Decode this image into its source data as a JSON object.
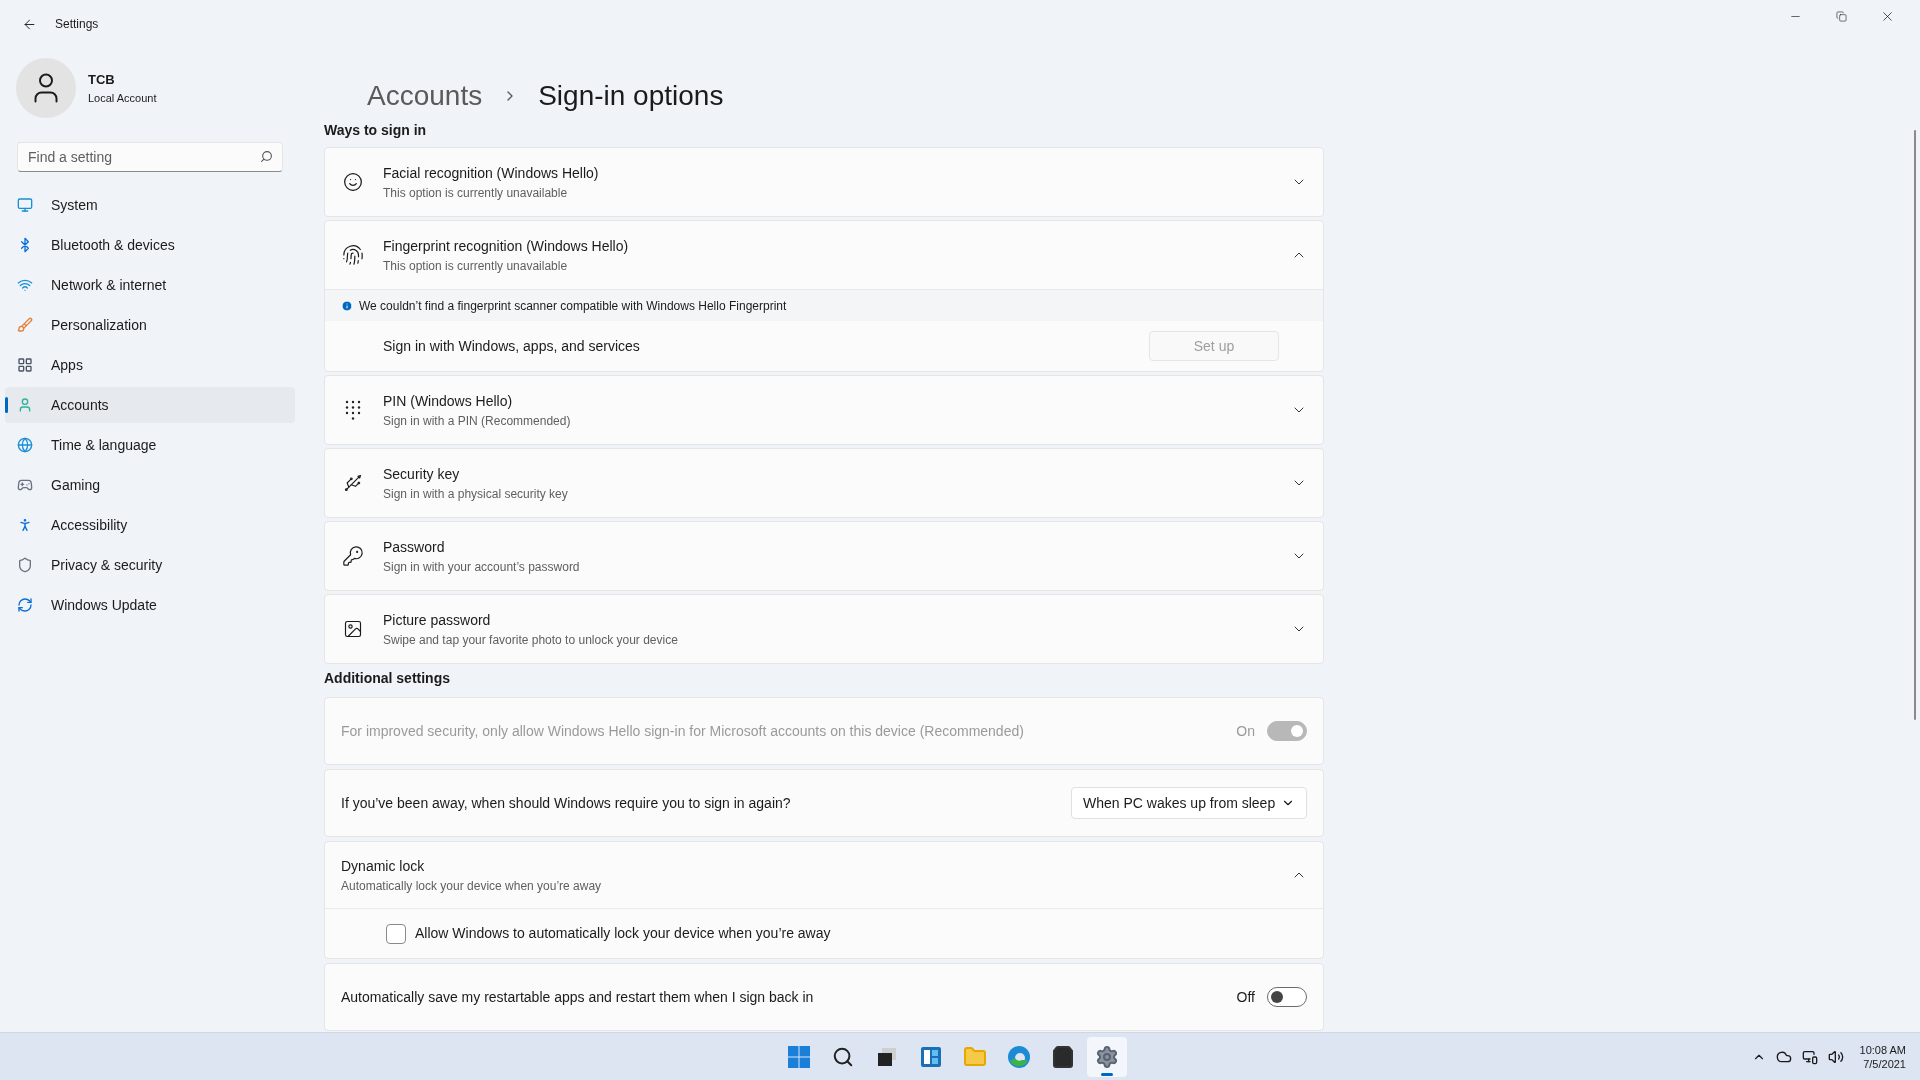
{
  "window": {
    "title": "Settings"
  },
  "account": {
    "name": "TCB",
    "type": "Local Account"
  },
  "search": {
    "placeholder": "Find a setting"
  },
  "nav": [
    {
      "label": "System",
      "selected": false
    },
    {
      "label": "Bluetooth & devices",
      "selected": false
    },
    {
      "label": "Network & internet",
      "selected": false
    },
    {
      "label": "Personalization",
      "selected": false
    },
    {
      "label": "Apps",
      "selected": false
    },
    {
      "label": "Accounts",
      "selected": true
    },
    {
      "label": "Time & language",
      "selected": false
    },
    {
      "label": "Gaming",
      "selected": false
    },
    {
      "label": "Accessibility",
      "selected": false
    },
    {
      "label": "Privacy & security",
      "selected": false
    },
    {
      "label": "Windows Update",
      "selected": false
    }
  ],
  "breadcrumb": {
    "parent": "Accounts",
    "current": "Sign-in options"
  },
  "ways_to_sign_in": {
    "heading": "Ways to sign in",
    "options": [
      {
        "title": "Facial recognition (Windows Hello)",
        "subtitle": "This option is currently unavailable",
        "expanded": false
      },
      {
        "title": "Fingerprint recognition (Windows Hello)",
        "subtitle": "This option is currently unavailable",
        "expanded": true,
        "info": "We couldn’t find a fingerprint scanner compatible with Windows Hello Fingerprint",
        "row_label": "Sign in with Windows, apps, and services",
        "button": {
          "label": "Set up",
          "disabled": true
        }
      },
      {
        "title": "PIN (Windows Hello)",
        "subtitle": "Sign in with a PIN (Recommended)",
        "expanded": false
      },
      {
        "title": "Security key",
        "subtitle": "Sign in with a physical security key",
        "expanded": false
      },
      {
        "title": "Password",
        "subtitle": "Sign in with your account’s password",
        "expanded": false
      },
      {
        "title": "Picture password",
        "subtitle": "Swipe and tap your favorite photo to unlock your device",
        "expanded": false
      }
    ]
  },
  "additional_settings": {
    "heading": "Additional settings",
    "items": [
      {
        "kind": "toggle",
        "label": "For improved security, only allow Windows Hello sign-in for Microsoft accounts on this device (Recommended)",
        "state_label": "On",
        "on": true,
        "disabled": true
      },
      {
        "kind": "dropdown",
        "label": "If you’ve been away, when should Windows require you to sign in again?",
        "value": "When PC wakes up from sleep"
      },
      {
        "kind": "expander",
        "title": "Dynamic lock",
        "subtitle": "Automatically lock your device when you’re away",
        "expanded": true,
        "checkbox": {
          "label": "Allow Windows to automatically lock your device when you’re away",
          "checked": false
        }
      },
      {
        "kind": "toggle",
        "label": "Automatically save my restartable apps and restart them when I sign back in",
        "state_label": "Off",
        "on": false,
        "disabled": false
      }
    ]
  },
  "taskbar": {
    "apps": [
      {
        "selected": false
      },
      {
        "selected": false
      },
      {
        "selected": false
      },
      {
        "selected": false
      },
      {
        "selected": false
      },
      {
        "selected": false
      },
      {
        "selected": false
      },
      {
        "selected": true
      }
    ],
    "time": "10:08 AM",
    "date": "7/5/2021"
  }
}
